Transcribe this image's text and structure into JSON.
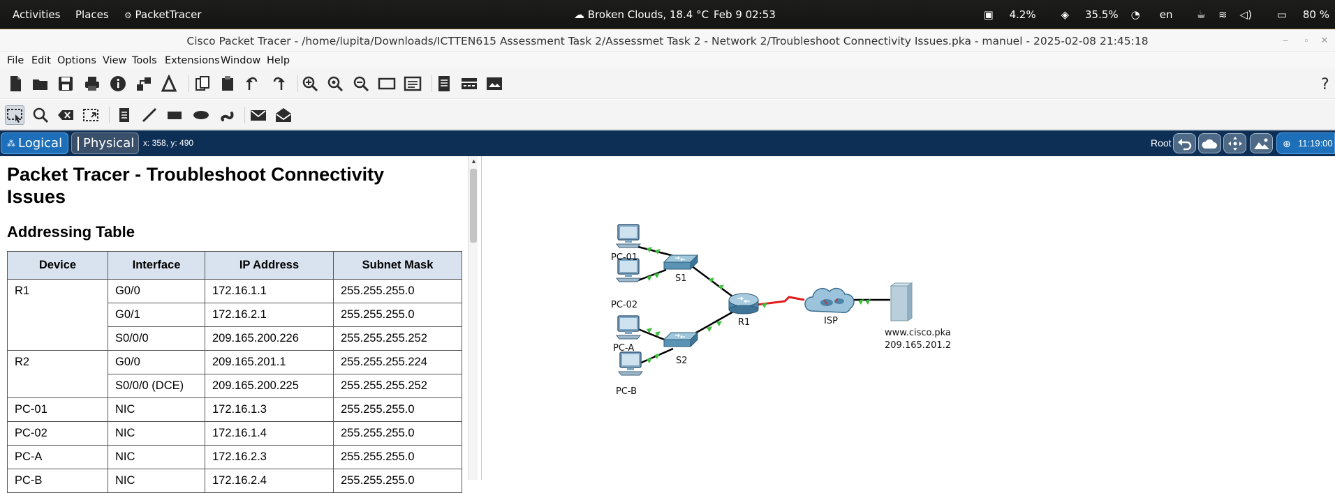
{
  "topbar": {
    "activities": "Activities",
    "places": "Places",
    "app": "PacketTracer",
    "weather": "Broken Clouds, 18.4 °C",
    "datetime": "Feb 9  02:53",
    "cpu": "4.2%",
    "mem": "35.5%",
    "lang": "en",
    "battery": "80 %"
  },
  "window": {
    "title": "Cisco Packet Tracer - /home/lupita/Downloads/ICTTEN615 Assessment Task 2/Assessmet Task 2 - Network 2/Troubleshoot Connectivity Issues.pka - manuel - 2025-02-08 21:45:18"
  },
  "menu": {
    "file": "File",
    "edit": "Edit",
    "options": "Options",
    "view": "View",
    "tools": "Tools",
    "extensions": "Extensions",
    "window": "Window",
    "help": "Help"
  },
  "workspace": {
    "logical": "Logical",
    "physical": "Physical",
    "coords": "x: 358, y: 490",
    "root": "Root",
    "clock": "11:19:00"
  },
  "doc": {
    "title": "Packet Tracer - Troubleshoot Connectivity Issues",
    "heading": "Addressing Table",
    "columns": [
      "Device",
      "Interface",
      "IP Address",
      "Subnet Mask"
    ],
    "rows": [
      [
        "R1",
        "G0/0",
        "172.16.1.1",
        "255.255.255.0"
      ],
      [
        "",
        "G0/1",
        "172.16.2.1",
        "255.255.255.0"
      ],
      [
        "",
        "S0/0/0",
        "209.165.200.226",
        "255.255.255.252"
      ],
      [
        "R2",
        "G0/0",
        "209.165.201.1",
        "255.255.255.224"
      ],
      [
        "",
        "S0/0/0 (DCE)",
        "209.165.200.225",
        "255.255.255.252"
      ],
      [
        "PC-01",
        "NIC",
        "172.16.1.3",
        "255.255.255.0"
      ],
      [
        "PC-02",
        "NIC",
        "172.16.1.4",
        "255.255.255.0"
      ],
      [
        "PC-A",
        "NIC",
        "172.16.2.3",
        "255.255.255.0"
      ],
      [
        "PC-B",
        "NIC",
        "172.16.2.4",
        "255.255.255.0"
      ]
    ]
  },
  "topology": {
    "devices": {
      "pc01": "PC-01",
      "pc02": "PC-02",
      "pca": "PC-A",
      "pcb": "PC-B",
      "s1": "S1",
      "s2": "S2",
      "r1": "R1",
      "isp": "ISP",
      "server_name": "www.cisco.pka",
      "server_ip": "209.165.201.2"
    },
    "colors": {
      "link": "#000000",
      "serial_link": "#e11b1b",
      "link_up": "#3cbf3c"
    }
  }
}
